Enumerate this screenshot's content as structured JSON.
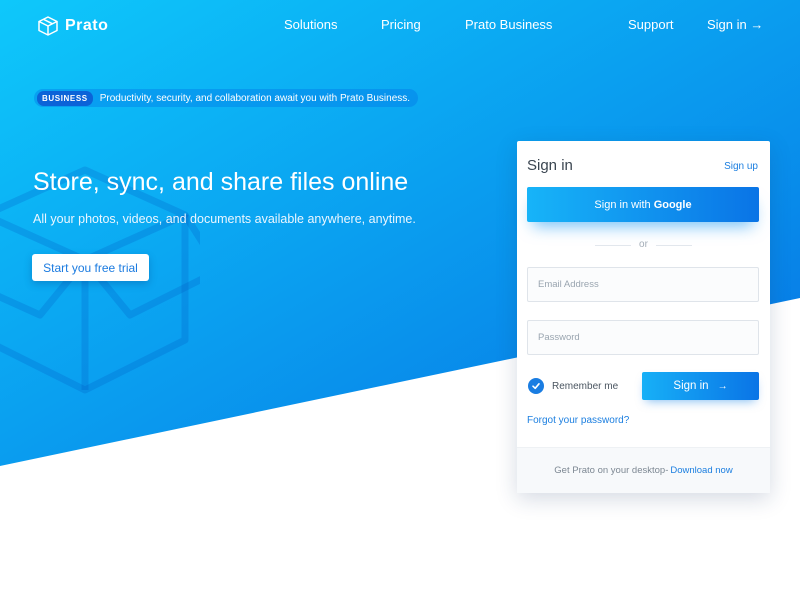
{
  "brand": {
    "name": "Prato",
    "logo_icon": "cube-logo-icon"
  },
  "nav": {
    "links": [
      "Solutions",
      "Pricing",
      "Prato Business",
      "Support"
    ],
    "sign_in": "Sign in →"
  },
  "announcement": {
    "badge": "BUSINESS",
    "text": "Productivity, security, and collaboration await you with Prato Business."
  },
  "hero": {
    "headline": "Store, sync, and share files online",
    "subline": "All your photos, videos, and documents available anywhere, anytime.",
    "cta": "Start you free trial",
    "watermark_icon": "open-box-icon"
  },
  "signin_card": {
    "title": "Sign in",
    "signup_link": "Sign up",
    "google_prefix": "Sign in with",
    "google_brand": "Google",
    "divider": "or",
    "email_placeholder": "Email Address",
    "password_placeholder": "Password",
    "remember_label": "Remember me",
    "remember_checked": true,
    "submit": "Sign in",
    "submit_icon": "arrow-right-icon",
    "forgot": "Forgot your password?",
    "footer_text": "Get Prato on your desktop-",
    "footer_link": "Download now"
  },
  "colors": {
    "gradient_start": "#0ec8fb",
    "gradient_end": "#0671e3",
    "accent": "#1c7fe0",
    "badge": "#0b63d8"
  }
}
